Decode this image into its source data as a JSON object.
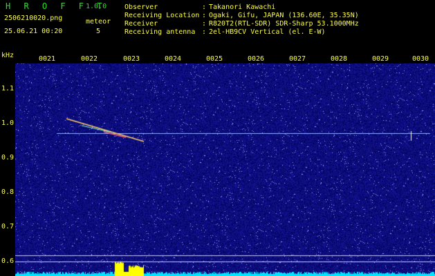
{
  "app": {
    "name": "H R O F F T",
    "version": "1.0.0"
  },
  "file": {
    "name": "2506210020.png",
    "datetime": "25.06.21 00:20"
  },
  "detection": {
    "label": "meteor",
    "count": "5"
  },
  "info": [
    {
      "key": "Observer",
      "sep": ":",
      "value": "Takanori Kawachi"
    },
    {
      "key": "Receiving Location",
      "sep": ":",
      "value": "Ogaki, Gifu, JAPAN (136.60E, 35.35N)"
    },
    {
      "key": "Receiver",
      "sep": ":",
      "value": "R820T2(RTL-SDR) SDR-Sharp 53.1000MHz"
    },
    {
      "key": "Receiving antenna",
      "sep": ":",
      "value": "2el-HB9CV Vertical (el. E-W)"
    }
  ],
  "axis": {
    "unit": "kHz",
    "x_ticks": [
      "0021",
      "0022",
      "0023",
      "0024",
      "0025",
      "0026",
      "0027",
      "0028",
      "0029",
      "0030"
    ],
    "y_ticks": [
      "1.1",
      "1.0",
      "0.9",
      "0.8",
      "0.7",
      "0.6"
    ]
  },
  "colors": {
    "label_yellow": "#ffff44",
    "label_green": "#33dd33",
    "background_noise": "#10107a",
    "carrier_line": "#66ccff",
    "meteor_trace": "#ffcc66",
    "level_bar": "#00e5ff",
    "level_peak": "#ffff00"
  }
}
